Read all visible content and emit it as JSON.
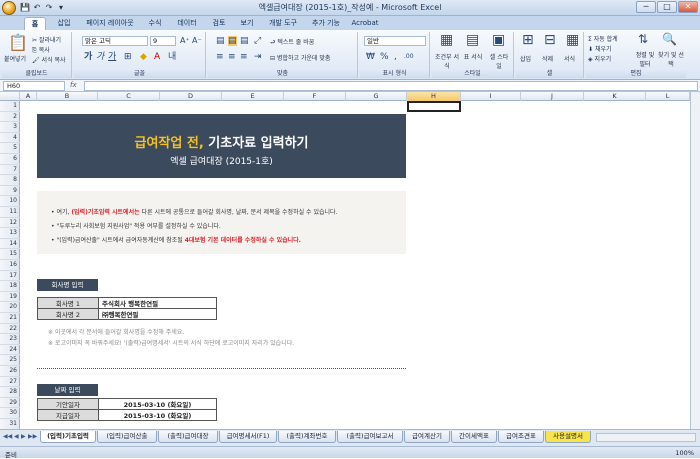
{
  "window": {
    "title": "엑셀급여대장 (2015-1호)_작성예 - Microsoft Excel",
    "min": "─",
    "max": "□",
    "close": "✕"
  },
  "quick_access": [
    "💾",
    "↶",
    "↷",
    "▾"
  ],
  "ribbon_tabs": [
    "홈",
    "삽입",
    "페이지 레이아웃",
    "수식",
    "데이터",
    "검토",
    "보기",
    "개발 도구",
    "추가 기능",
    "Acrobat"
  ],
  "ribbon": {
    "clipboard": {
      "paste": "붙여넣기",
      "cut": "잘라내기",
      "copy": "복사",
      "format_painter": "서식 복사",
      "label": "클립보드"
    },
    "font": {
      "name": "맑은 고딕",
      "size": "9",
      "label": "글꼴"
    },
    "alignment": {
      "wrap": "텍스트 줄 바꿈",
      "merge": "병합하고 가운데 맞춤",
      "label": "맞춤"
    },
    "number": {
      "format": "일반",
      "label": "표시 형식"
    },
    "styles": {
      "conditional": "조건부 서식",
      "table": "표 서식",
      "cell": "셀 스타일",
      "label": "스타일"
    },
    "cells": {
      "insert": "삽입",
      "delete": "삭제",
      "format": "서식",
      "label": "셀"
    },
    "editing": {
      "autosum": "Σ 자동 합계",
      "fill": "채우기",
      "clear": "지우기",
      "sort": "정렬 및 필터",
      "find": "찾기 및 선택",
      "label": "편집"
    }
  },
  "formula_bar": {
    "name_box": "H60",
    "fx": "fx",
    "value": ""
  },
  "columns": [
    "A",
    "B",
    "C",
    "D",
    "E",
    "F",
    "G",
    "H",
    "I",
    "J",
    "K",
    "L"
  ],
  "selected_column": "H",
  "rows": [
    "1",
    "2",
    "3",
    "4",
    "5",
    "6",
    "7",
    "8",
    "9",
    "10",
    "11",
    "12",
    "13",
    "14",
    "15",
    "16",
    "17",
    "18",
    "19",
    "20",
    "21",
    "22",
    "23",
    "24",
    "25",
    "26",
    "27",
    "28",
    "29",
    "30",
    "31"
  ],
  "banner": {
    "title_accent": "급여작업 전,",
    "title_rest": " 기초자료 입력하기",
    "subtitle": "엑셀 급여대장 (2015-1호)"
  },
  "notes": {
    "n1_pre": "여기, ",
    "n1_red": "(입력)기초입력 시트에서는",
    "n1_post": " 다른 시트에 공통으로 들어갈 회사명, 날짜, 문서 제목을 수정하실 수 있습니다.",
    "n2": "\"두루누리 사회보험 지원사업\" 적용 여부를 설정하실 수 있습니다.",
    "n3_pre": "\"(입력)급여산출\" 시트에서 급여자동계산에 참조될 ",
    "n3_red": "4대보험 기본 데이터를 수정하실 수 있습니다."
  },
  "company": {
    "section": "회사명 입력",
    "rows": [
      {
        "label": "회사명 1",
        "value": "주식회사 행복한연필"
      },
      {
        "label": "회사명 2",
        "value": "㈜행복한연필"
      }
    ],
    "hint1": "※ 이곳에서 각 문서에 들어갈 회사명을 수정해 주세요.",
    "hint2": "※ 로고이미지 꼭 바꿔주세요! '(출력)급여명세서' 시트의 서식 하단에 로고이미지 자리가 있습니다."
  },
  "dates": {
    "section": "날짜 입력",
    "rows": [
      {
        "label": "기안일자",
        "value": "2015-03-10 (화요일)"
      },
      {
        "label": "지급일자",
        "value": "2015-03-10 (화요일)"
      }
    ]
  },
  "sheet_tabs": [
    "(입력)기초입력",
    "(입력)급여산출",
    "(출력)급여대장",
    "급여명세서(F1)",
    "(출력)계좌번호",
    "(출력)급여보고서",
    "급여계산기",
    "간이세액표",
    "급여조견표",
    "사용설명서"
  ],
  "sheet_nav": [
    "◀◀",
    "◀",
    "▶",
    "▶▶"
  ],
  "status": {
    "ready": "준비",
    "zoom": "100%"
  }
}
